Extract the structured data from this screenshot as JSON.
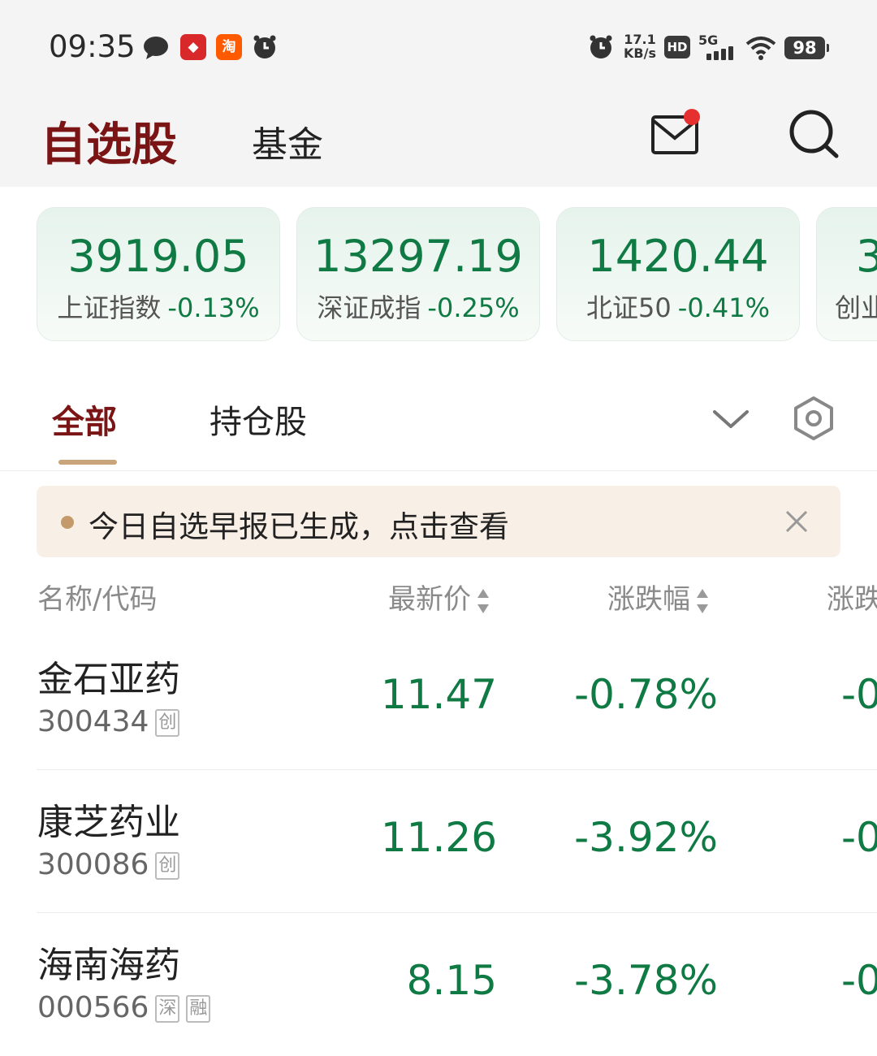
{
  "status_bar": {
    "time": "09:35",
    "net_speed_value": "17.1",
    "net_speed_unit": "KB/s",
    "hd": "HD",
    "signal": "5G",
    "battery": "98",
    "app_badge_taobao": "淘"
  },
  "header": {
    "tab_watchlist": "自选股",
    "tab_fund": "基金"
  },
  "indices": [
    {
      "value": "3919.05",
      "name": "上证指数",
      "change": "-0.13%"
    },
    {
      "value": "13297.19",
      "name": "深证成指",
      "change": "-0.25%"
    },
    {
      "value": "1420.44",
      "name": "北证50",
      "change": "-0.41%"
    },
    {
      "value": "3",
      "name": "创业",
      "change": ""
    }
  ],
  "sub_tabs": {
    "all": "全部",
    "holdings": "持仓股"
  },
  "notice": {
    "text": "今日自选早报已生成，点击查看"
  },
  "columns": {
    "name_code": "名称/代码",
    "latest_price": "最新价",
    "change_pct": "涨跌幅",
    "change_amt": "涨跌"
  },
  "stocks": [
    {
      "name": "金石亚药",
      "code": "300434",
      "tags": [
        "创"
      ],
      "price": "11.47",
      "change_pct": "-0.78%",
      "change_amt": "-0"
    },
    {
      "name": "康芝药业",
      "code": "300086",
      "tags": [
        "创"
      ],
      "price": "11.26",
      "change_pct": "-3.92%",
      "change_amt": "-0"
    },
    {
      "name": "海南海药",
      "code": "000566",
      "tags": [
        "深",
        "融"
      ],
      "price": "8.15",
      "change_pct": "-3.78%",
      "change_amt": "-0"
    }
  ],
  "colors": {
    "brand": "#7b1414",
    "down_green": "#0f7a43",
    "notice_bg": "#f8efe6",
    "accent_underline": "#c9a37a"
  }
}
